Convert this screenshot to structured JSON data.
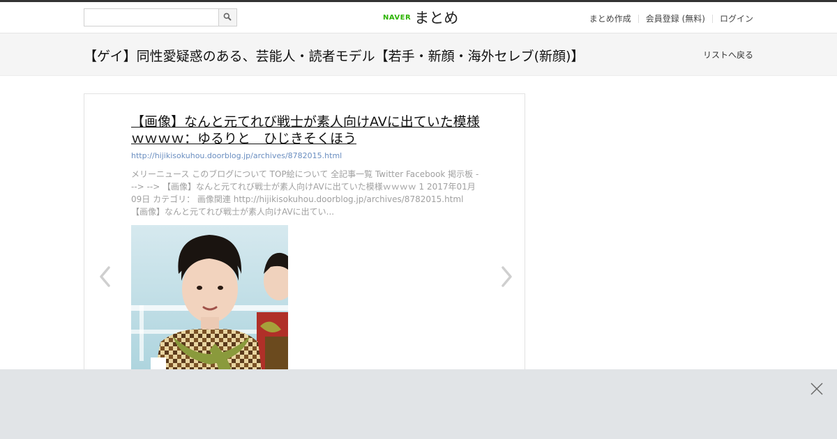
{
  "header": {
    "search_placeholder": "",
    "logo_brand": "NAVER",
    "logo_product": "まとめ",
    "nav": [
      {
        "label": "まとめ作成"
      },
      {
        "label": "会員登録 (無料)"
      },
      {
        "label": "ログイン"
      }
    ]
  },
  "titlebar": {
    "title": "【ゲイ】同性愛疑惑のある、芸能人・読者モデル【若手・新顔・海外セレブ(新顔)】",
    "back_label": "リストへ戻る"
  },
  "item": {
    "title": "【画像】なんと元てれび戦士が素人向けAVに出ていた模様ｗｗｗｗ：ゆるりと　ひじきそくほう",
    "url": "http://hijikisokuhou.doorblog.jp/archives/8782015.html",
    "description": "メリーニュース このブログについて TOP絵について 全記事一覧 Twitter Facebook 掲示板 ---> --> 【画像】なんと元てれび戦士が素人向けAVに出ていた模様ｗｗｗｗ 1 2017年01月09日 カテゴリ： 画像関連 http://hijikisokuhou.doorblog.jp/archives/8782015.html 【画像】なんと元てれび戦士が素人向けAVに出てい..."
  },
  "icons": {
    "search": "search-icon",
    "prev": "chevron-left-icon",
    "next": "chevron-right-icon",
    "close": "close-icon"
  },
  "colors": {
    "naver_green": "#2db400",
    "url_blue": "#6a8ec0",
    "titlebar_bg": "#f5f5f5",
    "overlay_bg": "#e1e4e7"
  }
}
